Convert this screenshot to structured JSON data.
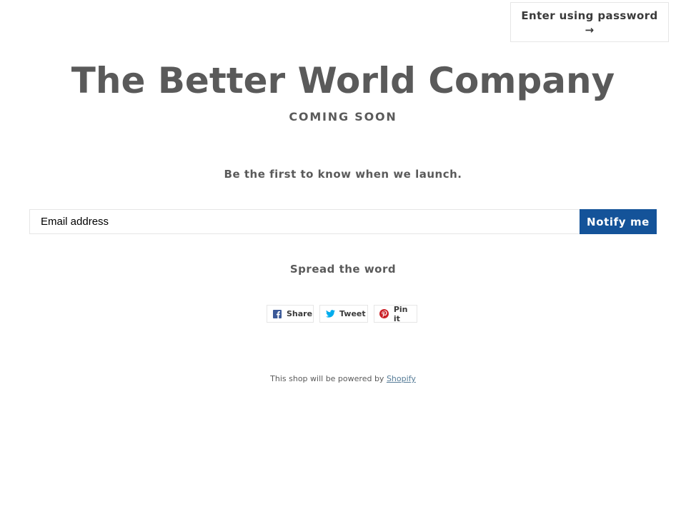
{
  "header": {
    "password_link_label": "Enter using password",
    "password_link_arrow": "→"
  },
  "main": {
    "title": "The Better World Company",
    "subtitle": "COMING SOON",
    "tagline": "Be the first to know when we launch."
  },
  "signup": {
    "email_placeholder": "Email address",
    "email_value": "",
    "submit_label": "Notify me"
  },
  "share": {
    "heading": "Spread the word",
    "buttons": [
      {
        "label": "Share",
        "icon": "facebook-icon",
        "color": "#3b5998"
      },
      {
        "label": "Tweet",
        "icon": "twitter-icon",
        "color": "#00aced"
      },
      {
        "label": "Pin it",
        "icon": "pinterest-icon",
        "color": "#cb2027"
      }
    ]
  },
  "footer": {
    "text": "This shop will be powered by",
    "link_label": "Shopify"
  },
  "colors": {
    "accent": "#145399",
    "text": "#5a5a5a",
    "link": "#557b97"
  }
}
